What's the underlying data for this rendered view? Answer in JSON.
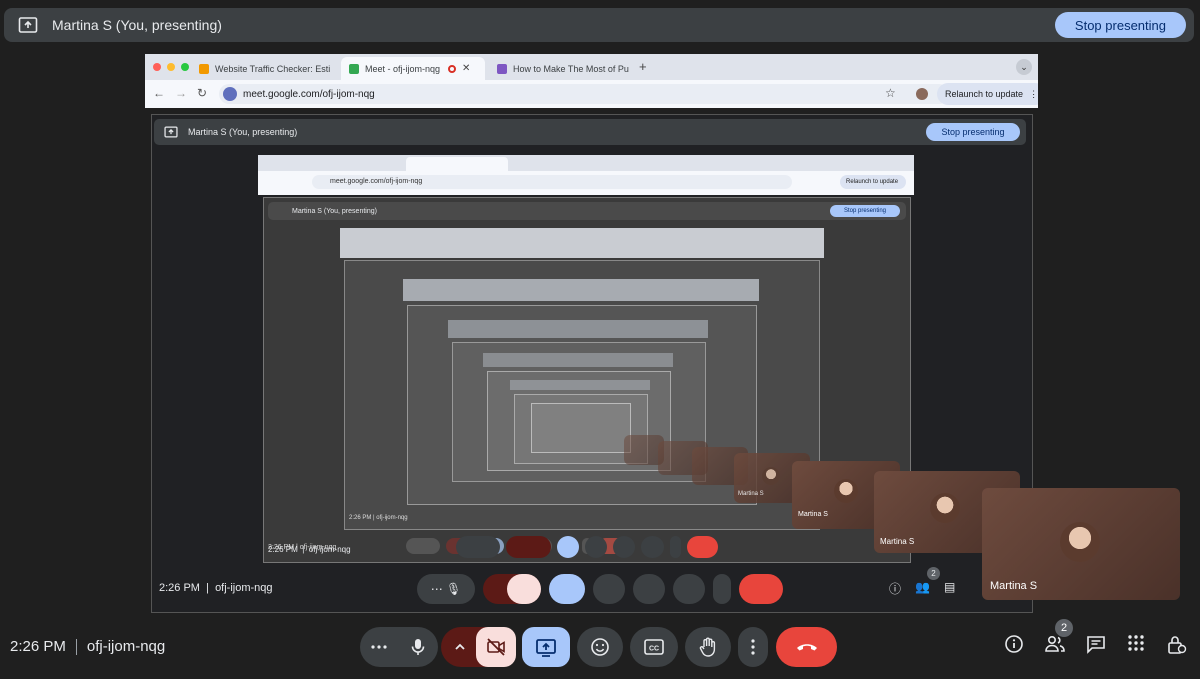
{
  "presenting_bar": {
    "text": "Martina S (You, presenting)",
    "stop_label": "Stop presenting"
  },
  "browser": {
    "tabs": [
      {
        "label": "Website Traffic Checker: Esti",
        "favicon_color": "#f29900"
      },
      {
        "label": "Meet - ofj-ijom-nqg",
        "favicon_color": "#34a853"
      },
      {
        "label": "How to Make The Most of Pu",
        "favicon_color": "#7e57c2"
      }
    ],
    "new_tab": "+",
    "url": "meet.google.com/ofj-ijom-nqg",
    "relaunch_label": "Relaunch to update"
  },
  "inner_meet": {
    "presenting_text": "Martina S (You, presenting)",
    "stop_label": "Stop presenting",
    "time": "2:26 PM",
    "code": "ofj-ijom-nqg",
    "people_count": "2"
  },
  "tiles": {
    "name": "Martina S"
  },
  "bottom": {
    "time": "2:26 PM",
    "meeting_code": "ofj-ijom-nqg",
    "people_count": "2"
  },
  "colors": {
    "end_call": "#e8453c",
    "present_active": "#a8c7fa",
    "camera_off": "#f9dedc",
    "mic_group": "#5c1a16"
  },
  "icons": [
    "present-icon",
    "more-icon",
    "mic-icon",
    "chevron-up-icon",
    "camera-off-icon",
    "present-screen-icon",
    "emoji-icon",
    "captions-icon",
    "raise-hand-icon",
    "more-vert-icon",
    "end-call-icon",
    "info-icon",
    "people-icon",
    "chat-icon",
    "apps-icon",
    "host-controls-icon"
  ]
}
